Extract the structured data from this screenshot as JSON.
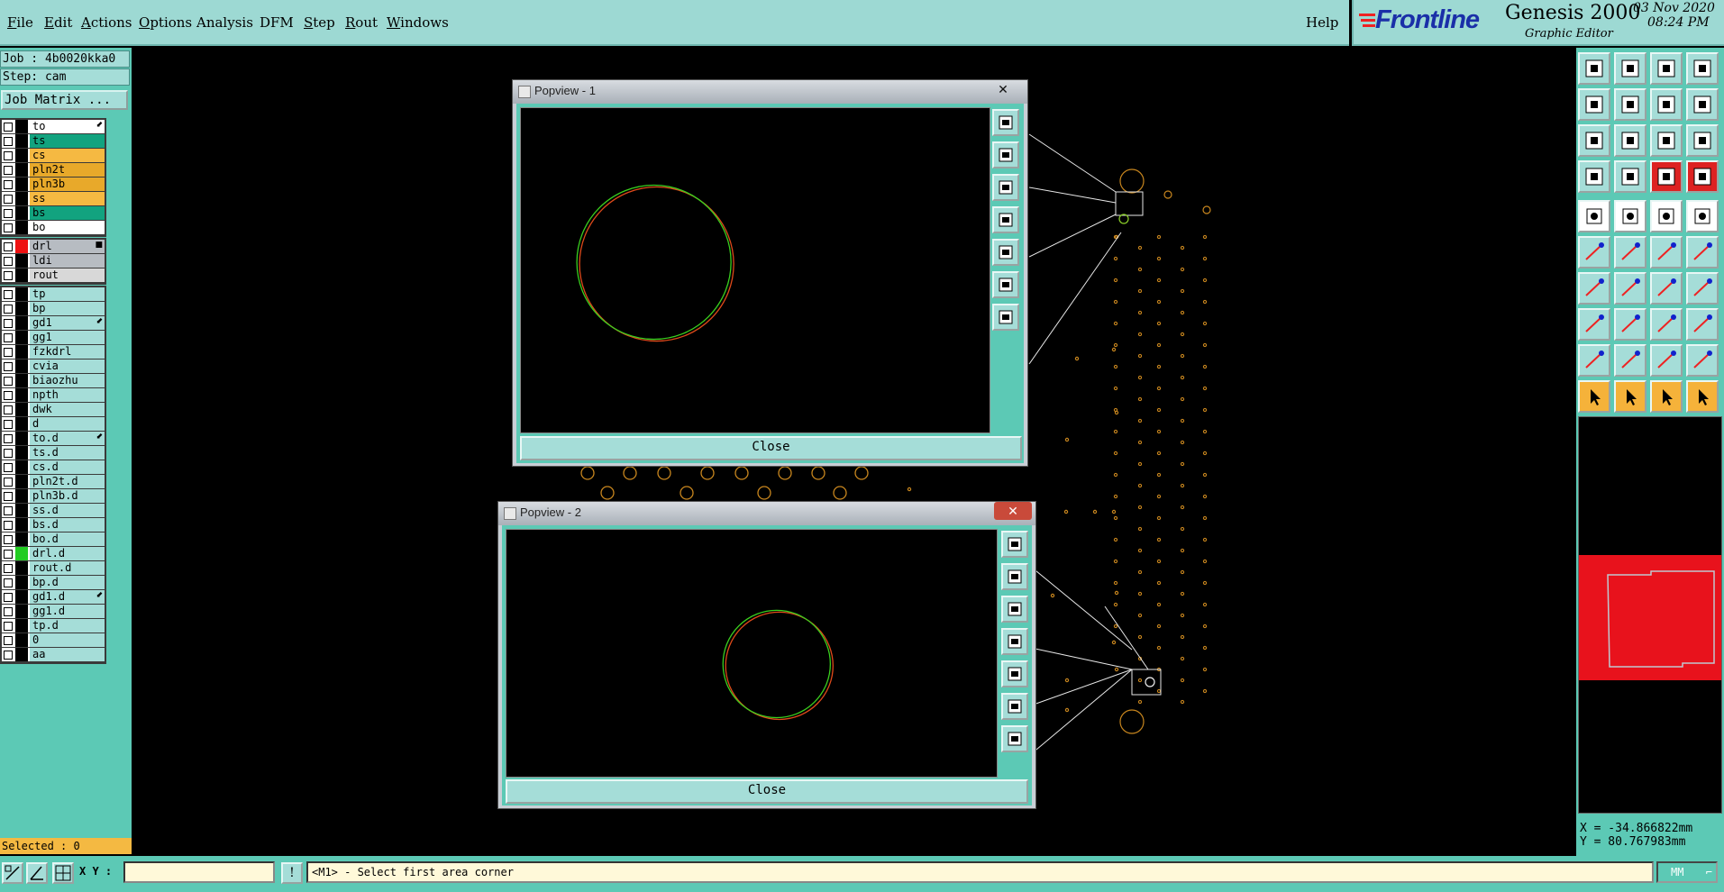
{
  "menu": {
    "items": [
      {
        "pre": "",
        "u": "F",
        "post": "ile"
      },
      {
        "pre": "",
        "u": "E",
        "post": "dit"
      },
      {
        "pre": "",
        "u": "A",
        "post": "ctions"
      },
      {
        "pre": "",
        "u": "O",
        "post": "ptions"
      },
      {
        "pre": "Analysis",
        "u": "",
        "post": ""
      },
      {
        "pre": "DFM",
        "u": "",
        "post": ""
      },
      {
        "pre": "",
        "u": "S",
        "post": "tep"
      },
      {
        "pre": "",
        "u": "R",
        "post": "out"
      },
      {
        "pre": "",
        "u": "W",
        "post": "indows"
      }
    ],
    "help": "Help"
  },
  "brand": {
    "logo": "Frontline",
    "product": "Genesis 2000",
    "subtitle": "Graphic Editor",
    "date": "03 Nov 2020",
    "time": "08:24 PM"
  },
  "job": {
    "job_line": "Job : 4b0020kka0",
    "step_line": "Step: cam",
    "matrix_button": "Job Matrix ..."
  },
  "layers": {
    "group1": [
      {
        "name": "to",
        "color": "#ffffff",
        "mark": "⬋"
      },
      {
        "name": "ts",
        "color": "#12a37f",
        "mark": ""
      },
      {
        "name": "cs",
        "color": "#f5b942",
        "mark": ""
      },
      {
        "name": "pln2t",
        "color": "#e8a92a",
        "mark": ""
      },
      {
        "name": "pln3b",
        "color": "#e8a92a",
        "mark": ""
      },
      {
        "name": "ss",
        "color": "#f5b942",
        "mark": ""
      },
      {
        "name": "bs",
        "color": "#12a37f",
        "mark": ""
      },
      {
        "name": "bo",
        "color": "#ffffff",
        "mark": ""
      }
    ],
    "group2": [
      {
        "name": "drl",
        "color": "#b7bcc2",
        "mark": "■",
        "swatch": "#ee1111"
      },
      {
        "name": "ldi",
        "color": "#b7bcc2",
        "mark": ""
      },
      {
        "name": "rout",
        "color": "#d8d8d8",
        "mark": ""
      }
    ],
    "group3": [
      {
        "name": "tp",
        "color": "#a5ddd8",
        "mark": ""
      },
      {
        "name": "bp",
        "color": "#a5ddd8",
        "mark": ""
      },
      {
        "name": "gd1",
        "color": "#a5ddd8",
        "mark": "⬋"
      },
      {
        "name": "gg1",
        "color": "#a5ddd8",
        "mark": ""
      },
      {
        "name": "fzkdrl",
        "color": "#a5ddd8",
        "mark": ""
      },
      {
        "name": "cvia",
        "color": "#a5ddd8",
        "mark": ""
      },
      {
        "name": "biaozhu",
        "color": "#a5ddd8",
        "mark": ""
      },
      {
        "name": "npth",
        "color": "#a5ddd8",
        "mark": ""
      },
      {
        "name": "dwk",
        "color": "#a5ddd8",
        "mark": ""
      },
      {
        "name": "d",
        "color": "#a5ddd8",
        "mark": ""
      },
      {
        "name": "to.d",
        "color": "#a5ddd8",
        "mark": "⬋"
      },
      {
        "name": "ts.d",
        "color": "#a5ddd8",
        "mark": ""
      },
      {
        "name": "cs.d",
        "color": "#a5ddd8",
        "mark": ""
      },
      {
        "name": "pln2t.d",
        "color": "#a5ddd8",
        "mark": ""
      },
      {
        "name": "pln3b.d",
        "color": "#a5ddd8",
        "mark": ""
      },
      {
        "name": "ss.d",
        "color": "#a5ddd8",
        "mark": ""
      },
      {
        "name": "bs.d",
        "color": "#a5ddd8",
        "mark": ""
      },
      {
        "name": "bo.d",
        "color": "#a5ddd8",
        "mark": ""
      },
      {
        "name": "drl.d",
        "color": "#a5ddd8",
        "mark": "",
        "swatch": "#22cc22"
      },
      {
        "name": "rout.d",
        "color": "#a5ddd8",
        "mark": ""
      },
      {
        "name": "bp.d",
        "color": "#a5ddd8",
        "mark": ""
      },
      {
        "name": "gd1.d",
        "color": "#a5ddd8",
        "mark": "⬋"
      },
      {
        "name": "gg1.d",
        "color": "#a5ddd8",
        "mark": ""
      },
      {
        "name": "tp.d",
        "color": "#a5ddd8",
        "mark": ""
      },
      {
        "name": "0",
        "color": "#a5ddd8",
        "mark": ""
      },
      {
        "name": "aa",
        "color": "#a5ddd8",
        "mark": ""
      }
    ]
  },
  "selected": "Selected : 0",
  "popviews": [
    {
      "title": "Popview - 1",
      "close_label": "Close"
    },
    {
      "title": "Popview - 2",
      "close_label": "Close"
    }
  ],
  "status": {
    "xy_label": "X Y :",
    "xy_value": "",
    "message": "<M1> - Select first area corner",
    "units": "MM"
  },
  "coords": {
    "x": "X = -34.866822mm",
    "y": "Y = 80.767983mm"
  },
  "toolbar_icons": [
    "layer-up-icon",
    "layer-down-icon",
    "home-icon",
    "copy-icon",
    "zoom-left-icon",
    "zoom-right-icon",
    "zoom-back-icon",
    "redraw-icon",
    "zoom-fit-icon",
    "zoom-home-icon",
    "scale-1-2-icon",
    "help-icon",
    "palette-icon",
    "probe-icon",
    "net-icon",
    "net-select-icon",
    "pad-icon",
    "line-icon",
    "ruler-icon",
    "circle-icon",
    "connect-icon",
    "cross-icon",
    "snap-icon",
    "add-point-icon",
    "slope-icon",
    "draw-line-icon",
    "rotate-icon",
    "text-icon",
    "move-icon",
    "segment-icon",
    "measure-icon",
    "group-icon",
    "angle-icon",
    "arc-icon",
    "arc-measure-icon",
    "arc-pointer-icon",
    "select-icon",
    "select-alt-icon",
    "select-single-icon",
    "select-multi-icon"
  ]
}
